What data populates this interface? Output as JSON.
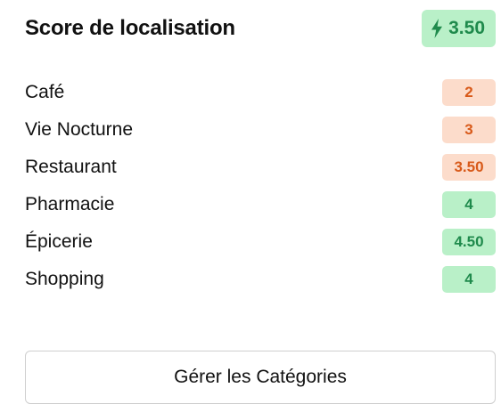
{
  "header": {
    "title": "Score de localisation",
    "overall_score": "3.50",
    "overall_icon": "bolt-icon",
    "overall_color": "#1f8a4c",
    "overall_bg": "#b9f0c8"
  },
  "categories": [
    {
      "label": "Café",
      "score": "2",
      "tone": "low"
    },
    {
      "label": "Vie Nocturne",
      "score": "3",
      "tone": "low"
    },
    {
      "label": "Restaurant",
      "score": "3.50",
      "tone": "low"
    },
    {
      "label": "Pharmacie",
      "score": "4",
      "tone": "high"
    },
    {
      "label": "Épicerie",
      "score": "4.50",
      "tone": "high"
    },
    {
      "label": "Shopping",
      "score": "4",
      "tone": "high"
    }
  ],
  "colors": {
    "low_bg": "#fcdccb",
    "low_text": "#d85a1a",
    "high_bg": "#b9f0c8",
    "high_text": "#1f8a4c"
  },
  "actions": {
    "manage_label": "Gérer les Catégories"
  }
}
